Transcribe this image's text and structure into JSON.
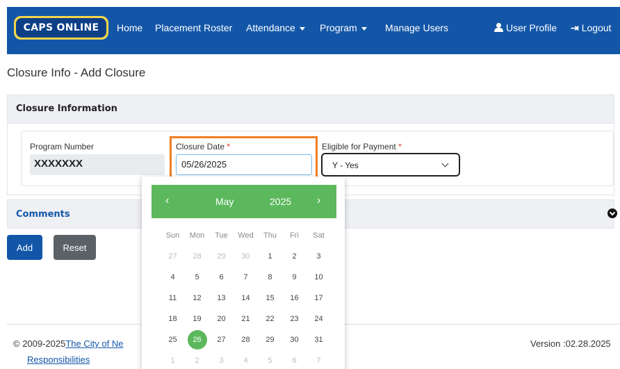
{
  "nav": {
    "logo_text": "CAPS ONLINE",
    "home": "Home",
    "placement_roster": "Placement Roster",
    "attendance": "Attendance",
    "program": "Program",
    "manage_users": "Manage Users",
    "user_profile": "User Profile",
    "logout": "Logout"
  },
  "page": {
    "title": "Closure Info - Add Closure"
  },
  "closure_panel": {
    "title": "Closure Information",
    "program_number_label": "Program Number",
    "program_number_value": "XXXXXXX",
    "closure_date_label": "Closure Date",
    "closure_date_value": "05/26/2025",
    "eligible_label": "Eligible for Payment",
    "eligible_value": "Y - Yes",
    "required_mark": "*"
  },
  "comments_panel": {
    "title": "Comments"
  },
  "buttons": {
    "add": "Add",
    "reset": "Reset"
  },
  "footer": {
    "copyright": "© 2009-2025",
    "link": "The City of Ne",
    "responsibilities": "Responsibilities",
    "version": "Version :02.28.2025"
  },
  "datepicker": {
    "prev": "‹",
    "next": "›",
    "month": "May",
    "year": "2025",
    "weekdays": [
      "Sun",
      "Mon",
      "Tue",
      "Wed",
      "Thu",
      "Fri",
      "Sat"
    ],
    "weeks": [
      [
        "27",
        "28",
        "29",
        "30",
        "1",
        "2",
        "3"
      ],
      [
        "4",
        "5",
        "6",
        "7",
        "8",
        "9",
        "10"
      ],
      [
        "11",
        "12",
        "13",
        "14",
        "15",
        "16",
        "17"
      ],
      [
        "18",
        "19",
        "20",
        "21",
        "22",
        "23",
        "24"
      ],
      [
        "25",
        "26",
        "27",
        "28",
        "29",
        "30",
        "31"
      ],
      [
        "1",
        "2",
        "3",
        "4",
        "5",
        "6",
        "7"
      ]
    ],
    "selected": "26"
  },
  "colors": {
    "nav": "#1356a8",
    "datepicker_accent": "#5cb85c",
    "highlight": "#f07f22"
  }
}
